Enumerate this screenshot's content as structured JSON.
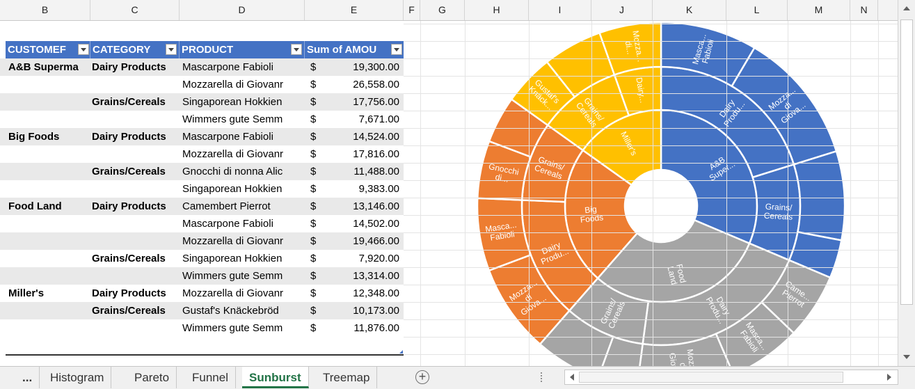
{
  "columns": [
    "B",
    "C",
    "D",
    "E",
    "F",
    "G",
    "H",
    "I",
    "J",
    "K",
    "L",
    "M",
    "N"
  ],
  "pivot": {
    "headers": [
      "CUSTOMEF",
      "CATEGORY",
      "PRODUCT",
      "Sum of AMOU"
    ],
    "rows": [
      {
        "customer": "A&B Superma",
        "category": "Dairy Products",
        "product": "Mascarpone Fabioli",
        "currency": "$",
        "amount": "19,300.00"
      },
      {
        "customer": "",
        "category": "",
        "product": "Mozzarella di Giovanr",
        "currency": "$",
        "amount": "26,558.00"
      },
      {
        "customer": "",
        "category": "Grains/Cereals",
        "product": "Singaporean Hokkien",
        "currency": "$",
        "amount": "17,756.00"
      },
      {
        "customer": "",
        "category": "",
        "product": "Wimmers gute Semm",
        "currency": "$",
        "amount": "7,671.00"
      },
      {
        "customer": "Big Foods",
        "category": "Dairy Products",
        "product": "Mascarpone Fabioli",
        "currency": "$",
        "amount": "14,524.00"
      },
      {
        "customer": "",
        "category": "",
        "product": "Mozzarella di Giovanr",
        "currency": "$",
        "amount": "17,816.00"
      },
      {
        "customer": "",
        "category": "Grains/Cereals",
        "product": "Gnocchi di nonna Alic",
        "currency": "$",
        "amount": "11,488.00"
      },
      {
        "customer": "",
        "category": "",
        "product": "Singaporean Hokkien",
        "currency": "$",
        "amount": "9,383.00"
      },
      {
        "customer": "Food Land",
        "category": "Dairy Products",
        "product": "Camembert Pierrot",
        "currency": "$",
        "amount": "13,146.00"
      },
      {
        "customer": "",
        "category": "",
        "product": "Mascarpone Fabioli",
        "currency": "$",
        "amount": "14,502.00"
      },
      {
        "customer": "",
        "category": "",
        "product": "Mozzarella di Giovanr",
        "currency": "$",
        "amount": "19,466.00"
      },
      {
        "customer": "",
        "category": "Grains/Cereals",
        "product": "Singaporean Hokkien",
        "currency": "$",
        "amount": "7,920.00"
      },
      {
        "customer": "",
        "category": "",
        "product": "Wimmers gute Semm",
        "currency": "$",
        "amount": "13,314.00"
      },
      {
        "customer": "Miller's",
        "category": "Dairy Products",
        "product": "Mozzarella di Giovanr",
        "currency": "$",
        "amount": "12,348.00"
      },
      {
        "customer": "",
        "category": "Grains/Cereals",
        "product": "Gustaf's Knäckebröd",
        "currency": "$",
        "amount": "10,173.00"
      },
      {
        "customer": "",
        "category": "",
        "product": "Wimmers gute Semm",
        "currency": "$",
        "amount": "11,876.00"
      }
    ]
  },
  "chart_data": {
    "type": "sunburst",
    "colors": {
      "A&B Superma": "#4472c4",
      "Big Foods": "#ed7d31",
      "Food Land": "#a5a5a5",
      "Miller's": "#ffc000"
    },
    "customers": [
      {
        "name": "A&B Superma",
        "label": [
          "A&B",
          "Super..."
        ],
        "children": [
          {
            "name": "Dairy Products",
            "label": [
              "Dairy",
              "Produ..."
            ],
            "children": [
              {
                "name": "Mascarpone Fabioli",
                "value": 19300,
                "label": [
                  "Masca...",
                  "Fabioli"
                ]
              },
              {
                "name": "Mozzarella di Giovanni",
                "value": 26558,
                "label": [
                  "Mozza...",
                  "di",
                  "Giova..."
                ]
              }
            ]
          },
          {
            "name": "Grains/Cereals",
            "label": [
              "Grains/",
              "Cereals"
            ],
            "children": [
              {
                "name": "Singaporean Hokkien",
                "value": 17756,
                "label": []
              },
              {
                "name": "Wimmers gute Semm",
                "value": 7671,
                "label": []
              }
            ]
          }
        ]
      },
      {
        "name": "Food Land",
        "label": [
          "Food",
          "Land"
        ],
        "children": [
          {
            "name": "Dairy Products",
            "label": [
              "Dairy",
              "Produ..."
            ],
            "children": [
              {
                "name": "Camembert Pierrot",
                "value": 13146,
                "label": [
                  "Came...",
                  "Pierrot"
                ]
              },
              {
                "name": "Mascarpone Fabioli",
                "value": 14502,
                "label": [
                  "Masca...",
                  "Fabioli"
                ]
              },
              {
                "name": "Mozzarella di Giovanni",
                "value": 19466,
                "label": [
                  "Mozza...",
                  "di",
                  "Giova..."
                ]
              }
            ]
          },
          {
            "name": "Grains/Cereals",
            "label": [
              "Grains/",
              "Cereals"
            ],
            "children": [
              {
                "name": "Singaporean Hokkien",
                "value": 7920,
                "label": []
              },
              {
                "name": "Wimmers gute Semm",
                "value": 13314,
                "label": []
              }
            ]
          }
        ]
      },
      {
        "name": "Big Foods",
        "label": [
          "Big",
          "Foods"
        ],
        "children": [
          {
            "name": "Dairy Products",
            "label": [
              "Dairy",
              "Produ..."
            ],
            "children": [
              {
                "name": "Mozzarella di Giovanni",
                "value": 17816,
                "label": [
                  "Mozza...",
                  "di",
                  "Giova..."
                ]
              },
              {
                "name": "Mascarpone Fabioli",
                "value": 14524,
                "label": [
                  "Masca...",
                  "Fabioli"
                ]
              }
            ]
          },
          {
            "name": "Grains/Cereals",
            "label": [
              "Grains/",
              "Cereals"
            ],
            "children": [
              {
                "name": "Gnocchi di nonna Alice",
                "value": 11488,
                "label": [
                  "Gnocchi",
                  "di..."
                ]
              },
              {
                "name": "Singaporean Hokkien",
                "value": 9383,
                "label": []
              }
            ]
          }
        ]
      },
      {
        "name": "Miller's",
        "label": [
          "Miller's"
        ],
        "children": [
          {
            "name": "Grains/Cereals",
            "label": [
              "Grains/",
              "Cereals"
            ],
            "children": [
              {
                "name": "Gustaf's Knäckebröd",
                "value": 10173,
                "label": [
                  "Gustaf's",
                  "Knäck..."
                ]
              },
              {
                "name": "Wimmers gute Semm",
                "value": 11876,
                "label": []
              }
            ]
          },
          {
            "name": "Dairy Products",
            "label": [
              "Dairy..."
            ],
            "children": [
              {
                "name": "Mozzarella di Giovanni",
                "value": 12348,
                "label": [
                  "Mozza...",
                  "di..."
                ]
              }
            ]
          }
        ]
      }
    ]
  },
  "tabs": [
    "...",
    "Histogram",
    "Pareto",
    "Funnel",
    "Sunburst",
    "Treemap"
  ],
  "active_tab": "Sunburst",
  "icons": {
    "add_sheet": "plus-circle-icon",
    "scroll_up": "triangle-up-icon",
    "scroll_down": "triangle-down-icon",
    "scroll_left": "triangle-left-icon",
    "scroll_right": "triangle-right-icon",
    "dropdown": "dropdown-arrow-icon"
  }
}
